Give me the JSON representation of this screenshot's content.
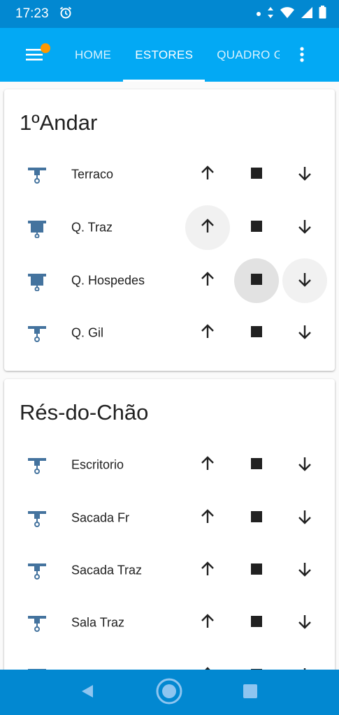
{
  "status_bar": {
    "time": "17:23",
    "icons": [
      "alarm-icon",
      "notification-dot-icon",
      "data-arrows-icon",
      "wifi-icon",
      "signal-icon",
      "battery-icon"
    ]
  },
  "toolbar": {
    "menu_icon": "menu-icon",
    "overflow_icon": "more-vert-icon",
    "tabs": [
      {
        "label": "HOME"
      },
      {
        "label": "ESTORES"
      },
      {
        "label": "QUADRO G"
      }
    ],
    "active_tab_index": 1,
    "colors": {
      "toolbar": "#03a9f4",
      "status_bar": "#0288d1",
      "badge": "#ff9800"
    }
  },
  "cards": [
    {
      "title": "1ºAndar",
      "rows": [
        {
          "label": "Terraco"
        },
        {
          "label": "Q. Traz"
        },
        {
          "label": "Q. Hospedes"
        },
        {
          "label": "Q. Gil"
        }
      ]
    },
    {
      "title": "Rés-do-Chão",
      "rows": [
        {
          "label": "Escritorio"
        },
        {
          "label": "Sacada Fr"
        },
        {
          "label": "Sacada Traz"
        },
        {
          "label": "Sala Traz"
        },
        {
          "label": ""
        }
      ]
    }
  ],
  "icon_color": "#44739e",
  "nav_bar": {
    "icons": [
      "back-icon",
      "home-icon",
      "recents-icon"
    ]
  }
}
